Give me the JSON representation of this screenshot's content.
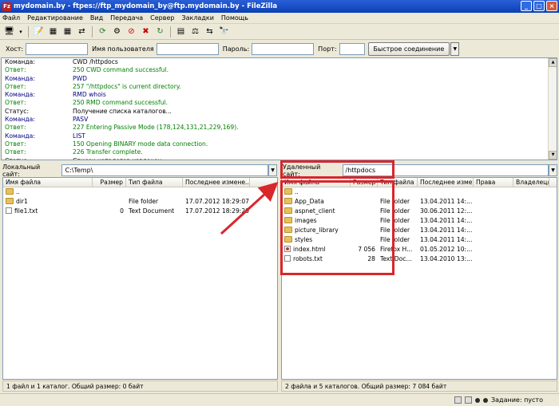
{
  "window": {
    "title": "mydomain.by - ftpes://ftp_mydomain_by@ftp.mydomain.by - FileZilla",
    "app_icon": "Fz",
    "minimize": "_",
    "maximize": "□",
    "close": "×"
  },
  "menu": [
    "Файл",
    "Редактирование",
    "Вид",
    "Передача",
    "Сервер",
    "Закладки",
    "Помощь"
  ],
  "toolbar": {
    "icons": [
      "site-manager-icon",
      "dropdown-arrow-icon",
      "toggle-log-icon",
      "toggle-local-tree-icon",
      "toggle-remote-tree-icon",
      "toggle-queue-icon",
      "refresh-icon",
      "process-queue-icon",
      "cancel-icon",
      "disconnect-icon",
      "reconnect-icon",
      "filter-icon",
      "compare-icon",
      "sync-browse-icon",
      "search-icon"
    ],
    "glyphs": [
      "🖥",
      "▾",
      "📝",
      "▦",
      "▦",
      "⇄",
      "⟳",
      "⚙",
      "⊘",
      "✖",
      "↻",
      "▤",
      "⚖",
      "⇆",
      "🔭"
    ]
  },
  "quickconnect": {
    "host_label": "Хост:",
    "user_label": "Имя пользователя",
    "pass_label": "Пароль:",
    "port_label": "Порт:",
    "host_value": "",
    "user_value": "",
    "pass_value": "",
    "port_value": "",
    "connect_button": "Быстрое соединение",
    "dropdown": "▼"
  },
  "log": [
    {
      "kind": "Команда:",
      "text": "CWD /httpdocs",
      "color": "#000000"
    },
    {
      "kind": "Ответ:",
      "text": "250 CWD command successful.",
      "color": "#008000"
    },
    {
      "kind": "Команда:",
      "text": "PWD",
      "color": "#000080"
    },
    {
      "kind": "Ответ:",
      "text": "257 \"/httpdocs\" is current directory.",
      "color": "#008000"
    },
    {
      "kind": "Команда:",
      "text": "RMD whois",
      "color": "#000080"
    },
    {
      "kind": "Ответ:",
      "text": "250 RMD command successful.",
      "color": "#008000"
    },
    {
      "kind": "Статус:",
      "text": "Получение списка каталогов...",
      "color": "#000000"
    },
    {
      "kind": "Команда:",
      "text": "PASV",
      "color": "#000080"
    },
    {
      "kind": "Ответ:",
      "text": "227 Entering Passive Mode (178,124,131,21,229,169).",
      "color": "#008000"
    },
    {
      "kind": "Команда:",
      "text": "LIST",
      "color": "#000080"
    },
    {
      "kind": "Ответ:",
      "text": "150 Opening BINARY mode data connection.",
      "color": "#008000"
    },
    {
      "kind": "Ответ:",
      "text": "226 Transfer complete.",
      "color": "#008000"
    },
    {
      "kind": "Статус:",
      "text": "Список каталогов извлечен",
      "color": "#000000"
    }
  ],
  "local": {
    "site_label": "Локальный сайт:",
    "path": "C:\\Temp\\",
    "columns": [
      "Имя файла",
      "Размер",
      "Тип файла",
      "Последнее измене..."
    ],
    "rows": [
      {
        "name": "..",
        "size": "",
        "type": "",
        "modified": "",
        "icon": "folder-icon"
      },
      {
        "name": "dir1",
        "size": "",
        "type": "File folder",
        "modified": "17.07.2012 18:29:07",
        "icon": "folder-icon"
      },
      {
        "name": "file1.txt",
        "size": "0",
        "type": "Text Document",
        "modified": "17.07.2012 18:29:20",
        "icon": "text-file-icon"
      }
    ],
    "status": "1 файл и 1 каталог. Общий размер: 0 байт"
  },
  "remote": {
    "site_label": "Удаленный сайт:",
    "path": "/httpdocs",
    "columns": [
      "Имя файла",
      "Размер",
      "Тип файла",
      "Последнее изме...",
      "Права",
      "Владелец/..."
    ],
    "rows": [
      {
        "name": "..",
        "size": "",
        "type": "",
        "modified": "",
        "perms": "",
        "owner": "",
        "icon": "folder-icon"
      },
      {
        "name": "App_Data",
        "size": "",
        "type": "File folder",
        "modified": "13.04.2011 14:...",
        "perms": "",
        "owner": "",
        "icon": "folder-icon"
      },
      {
        "name": "aspnet_client",
        "size": "",
        "type": "File folder",
        "modified": "30.06.2011 12:...",
        "perms": "",
        "owner": "",
        "icon": "folder-icon"
      },
      {
        "name": "images",
        "size": "",
        "type": "File folder",
        "modified": "13.04.2011 14:...",
        "perms": "",
        "owner": "",
        "icon": "folder-icon"
      },
      {
        "name": "picture_library",
        "size": "",
        "type": "File folder",
        "modified": "13.04.2011 14:...",
        "perms": "",
        "owner": "",
        "icon": "folder-icon"
      },
      {
        "name": "styles",
        "size": "",
        "type": "File folder",
        "modified": "13.04.2011 14:...",
        "perms": "",
        "owner": "",
        "icon": "folder-icon"
      },
      {
        "name": "index.html",
        "size": "7 056",
        "type": "Firefox H...",
        "modified": "01.05.2012 10:...",
        "perms": "",
        "owner": "",
        "icon": "html-file-icon"
      },
      {
        "name": "robots.txt",
        "size": "28",
        "type": "Text Doc...",
        "modified": "13.04.2010 13:...",
        "perms": "",
        "owner": "",
        "icon": "text-file-icon"
      }
    ],
    "status": "2 файла и 5 каталогов. Общий размер: 7 084 байт"
  },
  "bottom": {
    "queue_label": "Задание: пусто"
  },
  "colors": {
    "highlight": "#d9262b",
    "title_bar": "#1a4fc8"
  }
}
